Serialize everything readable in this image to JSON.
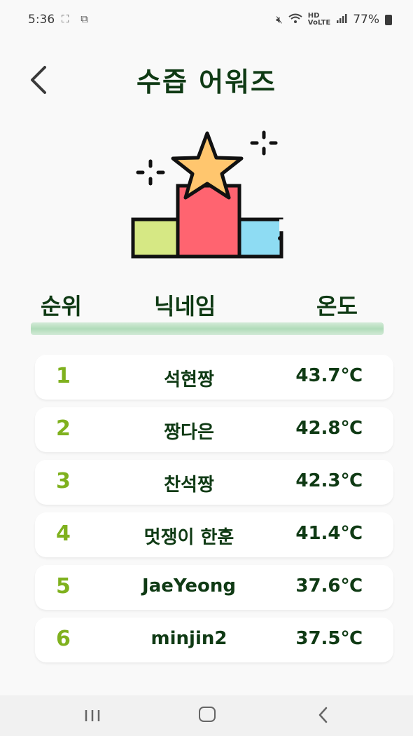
{
  "status_bar": {
    "time": "5:36",
    "battery": "77%",
    "left_icons": [
      "screenshot-icon",
      "screen-capture-icon"
    ],
    "right_icons": [
      "mute-icon",
      "wifi-icon",
      "hd-voice-icon",
      "signal-icon",
      "battery-icon"
    ]
  },
  "header": {
    "title": "수즙 어워즈"
  },
  "table_header": {
    "rank": "순위",
    "nickname": "닉네임",
    "temperature": "온도"
  },
  "rankings": [
    {
      "rank": "1",
      "name": "석현짱",
      "temp": "43.7℃"
    },
    {
      "rank": "2",
      "name": "짱다은",
      "temp": "42.8℃"
    },
    {
      "rank": "3",
      "name": "찬석짱",
      "temp": "42.3℃"
    },
    {
      "rank": "4",
      "name": "멋쟁이 한훈",
      "temp": "41.4℃"
    },
    {
      "rank": "5",
      "name": "JaeYeong",
      "temp": "37.6℃"
    },
    {
      "rank": "6",
      "name": "minjin2",
      "temp": "37.5℃"
    }
  ],
  "colors": {
    "title": "#0f3a14",
    "rank_number": "#7fb11e",
    "podium_left": "#d6e884",
    "podium_center": "#ff6470",
    "podium_right": "#8edcf3",
    "star": "#ffc66e"
  }
}
